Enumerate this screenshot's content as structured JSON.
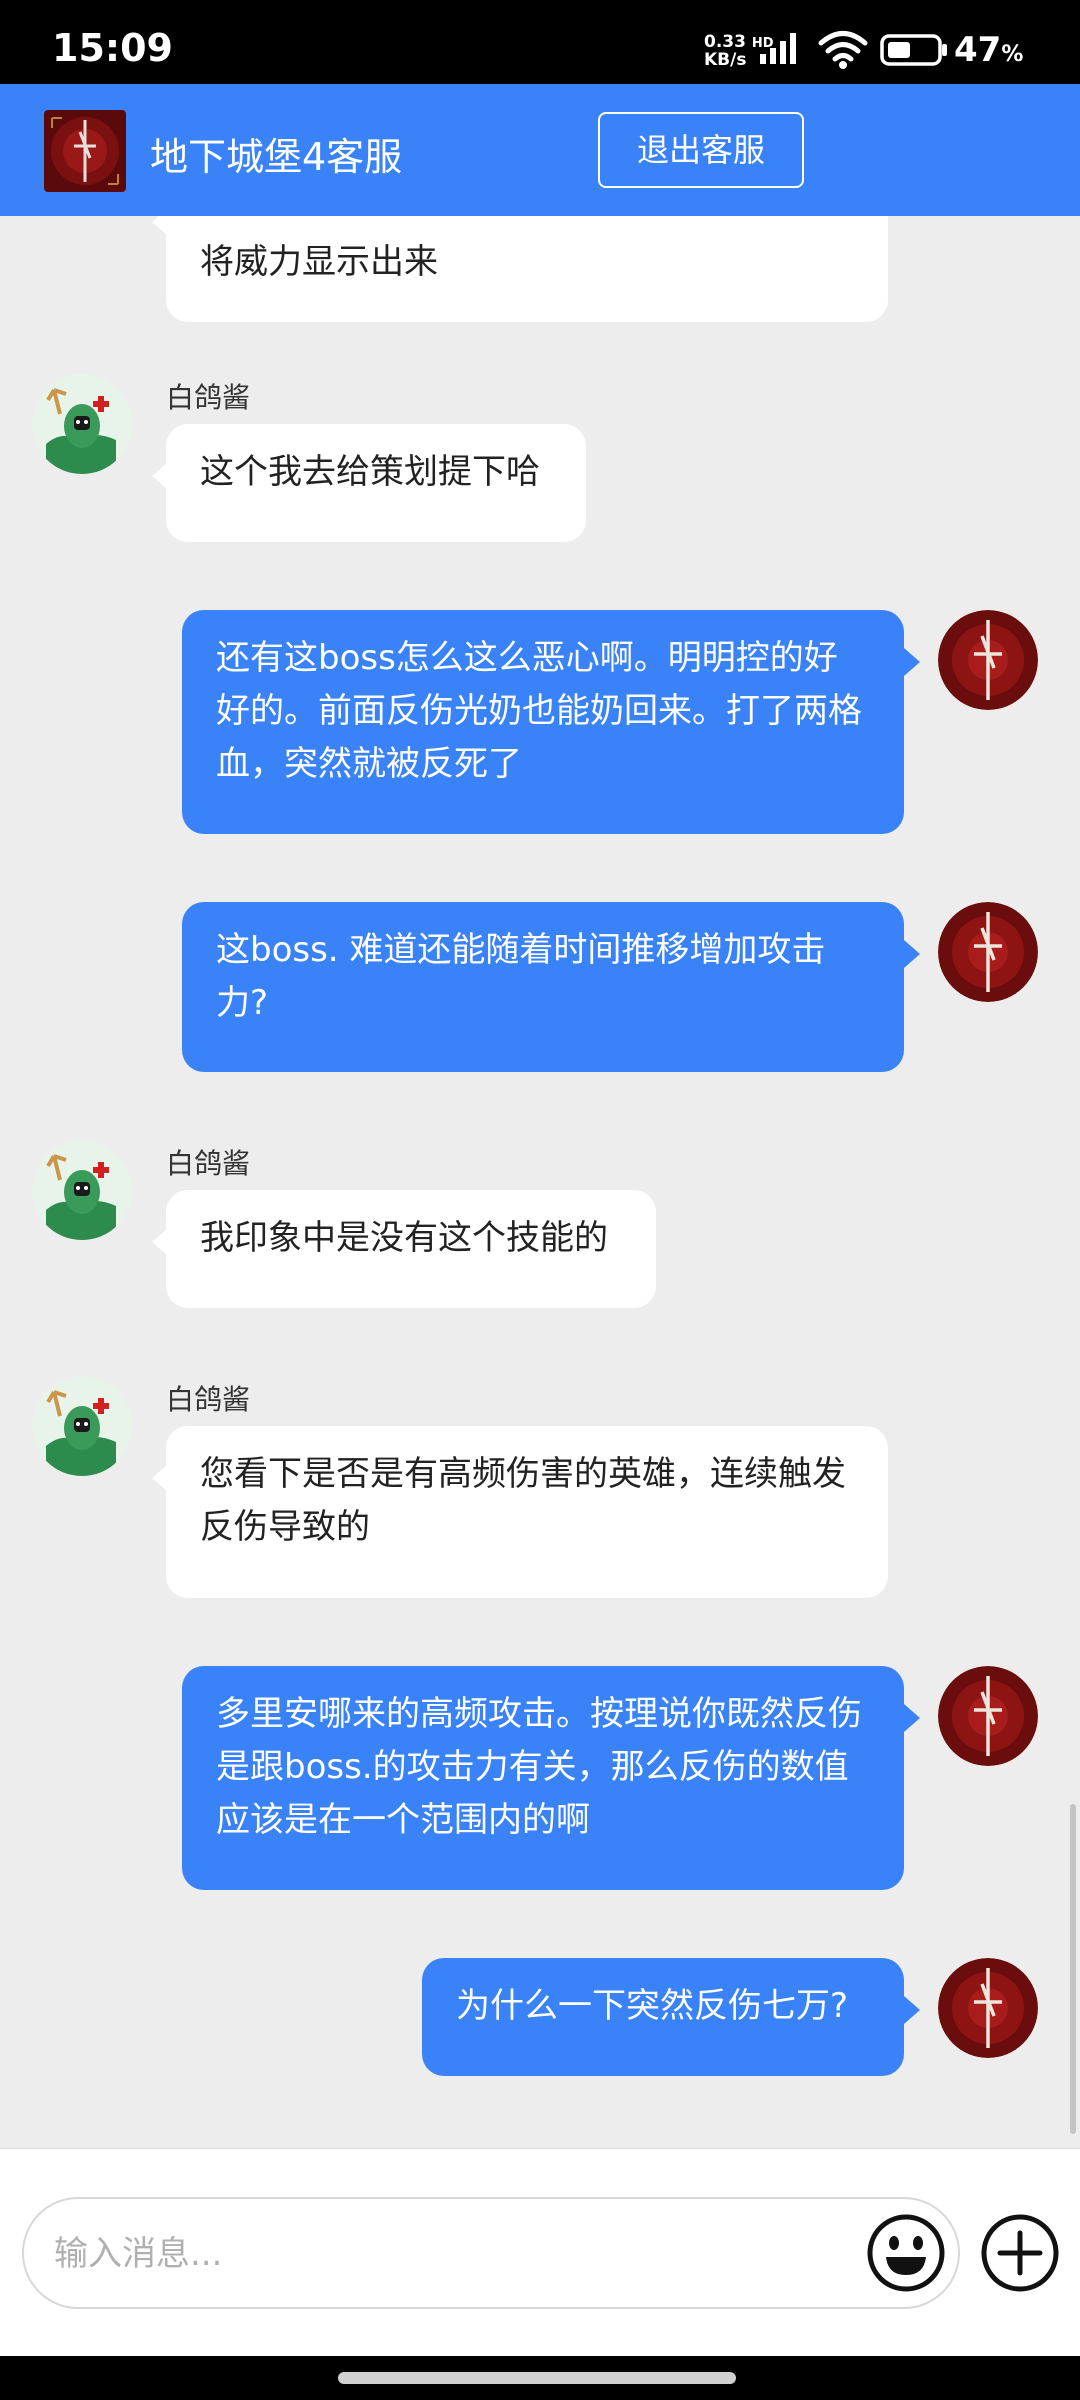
{
  "status_bar": {
    "time": "15:09",
    "net_speed_value": "0.33",
    "net_speed_unit": "KB/s",
    "net_type": "HD",
    "battery_percent": "47",
    "battery_symbol": "%",
    "battery_level": 0.47
  },
  "header": {
    "title": "地下城堡4客服",
    "exit_label": "退出客服",
    "accent_color": "#3a82f7"
  },
  "messages": [
    {
      "side": "left",
      "text": "将威力显示出来"
    },
    {
      "side": "left",
      "sender": "白鸽酱",
      "text": "这个我去给策划提下哈"
    },
    {
      "side": "right",
      "text": "还有这boss怎么这么恶心啊。明明控的好好的。前面反伤光奶也能奶回来。打了两格血，突然就被反死了"
    },
    {
      "side": "right",
      "text": "这boss. 难道还能随着时间推移增加攻击力?"
    },
    {
      "side": "left",
      "sender": "白鸽酱",
      "text": "我印象中是没有这个技能的"
    },
    {
      "side": "left",
      "sender": "白鸽酱",
      "text": "您看下是否是有高频伤害的英雄，连续触发反伤导致的"
    },
    {
      "side": "right",
      "text": "多里安哪来的高频攻击。按理说你既然反伤是跟boss.的攻击力有关，那么反伤的数值应该是在一个范围内的啊"
    },
    {
      "side": "right",
      "text": "为什么一下突然反伤七万?"
    }
  ],
  "input": {
    "placeholder": "输入消息..."
  },
  "icons": {
    "emoji": "emoji-icon",
    "plus": "plus-icon",
    "agent_avatar": "agent-avatar",
    "user_avatar": "user-avatar"
  }
}
